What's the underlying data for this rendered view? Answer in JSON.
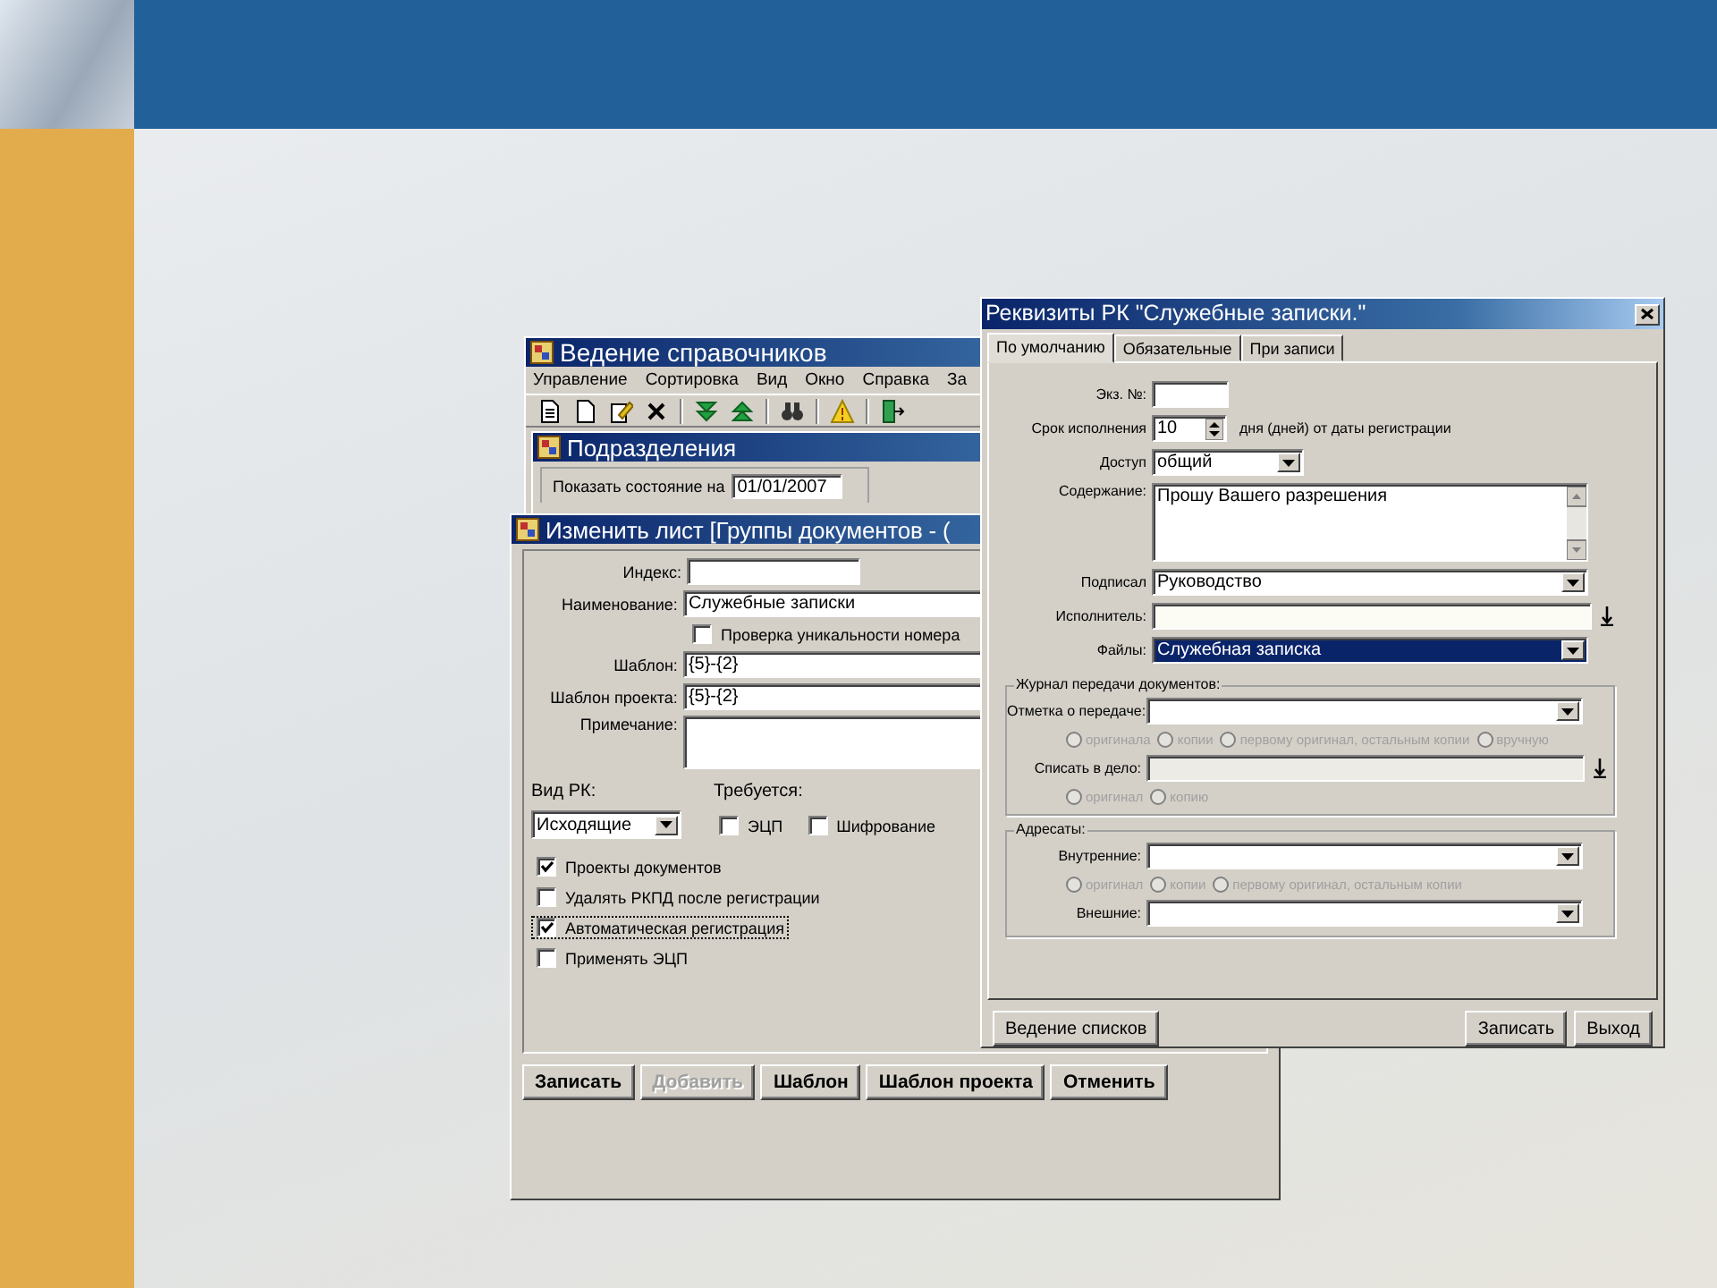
{
  "reference_window": {
    "title": "Ведение справочников",
    "menu": [
      "Управление",
      "Сортировка",
      "Вид",
      "Окно",
      "Справка",
      "За"
    ],
    "subwindow": {
      "title": "Подразделения",
      "date_label": "Показать состояние на",
      "date_value": "01/01/2007"
    }
  },
  "edit_window": {
    "title": "Изменить лист [Группы документов - (",
    "fields": [
      {
        "kind": "short",
        "label": "Индекс:"
      },
      {
        "kind": "wide",
        "label": "Наименование:",
        "value": "Служебные записки"
      },
      {
        "kind": "checkbox",
        "label": "Проверка уникальности номера",
        "checked": false
      },
      {
        "kind": "wide",
        "label": "Шаблон:",
        "value": "{5}-{2}"
      },
      {
        "kind": "wide",
        "label": "Шаблон проекта:",
        "value": "{5}-{2}"
      },
      {
        "kind": "memo",
        "label": "Примечание:"
      }
    ],
    "rk_type": {
      "label": "Вид РК:",
      "value": "Исходящие"
    },
    "required": {
      "label": "Требуется:",
      "options": [
        {
          "label": "ЭЦП",
          "checked": false
        },
        {
          "label": "Шифрование",
          "checked": false
        }
      ]
    },
    "options": [
      {
        "label": "Проекты документов",
        "checked": true,
        "focused": false
      },
      {
        "label": "Удалять РКПД после регистрации",
        "checked": false,
        "focused": false
      },
      {
        "label": "Автоматическая регистрация",
        "checked": true,
        "focused": true
      },
      {
        "label": "Применять ЭЦП",
        "checked": false,
        "focused": false
      }
    ],
    "buttons": [
      {
        "label": "Записать",
        "disabled": false
      },
      {
        "label": "Добавить",
        "disabled": true
      },
      {
        "label": "Шаблон",
        "disabled": false
      },
      {
        "label": "Шаблон проекта",
        "disabled": false
      },
      {
        "label": "Отменить",
        "disabled": false
      }
    ]
  },
  "dialog": {
    "title": "Реквизиты РК \"Служебные записки.\"",
    "tabs": [
      {
        "label": "По умолчанию",
        "selected": true
      },
      {
        "label": "Обязательные",
        "selected": false
      },
      {
        "label": "При записи",
        "selected": false
      }
    ],
    "rows": [
      {
        "kind": "short",
        "label": "Экз. №:"
      },
      {
        "kind": "spin",
        "label": "Срок исполнения",
        "value": "10",
        "suffix": "дня (дней) от даты регистрации"
      },
      {
        "kind": "combo_short",
        "label": "Доступ",
        "value": "общий"
      },
      {
        "kind": "memo",
        "label": "Содержание:",
        "value": "Прошу Вашего разрешения"
      },
      {
        "kind": "combo",
        "label": "Подписал",
        "value": "Руководство",
        "focused": false
      },
      {
        "kind": "lookup",
        "label": "Исполнитель:",
        "disabled": false
      },
      {
        "kind": "combo",
        "label": "Файлы:",
        "value": "Служебная записка",
        "focused": true
      }
    ],
    "groups": [
      {
        "title": "Журнал передачи документов:",
        "rows": [
          {
            "kind": "combo",
            "label": "Отметка о передаче:",
            "focused": false
          },
          {
            "kind": "radios",
            "options": [
              {
                "label": "оригинала",
                "selected": false,
                "disabled": true
              },
              {
                "label": "копии",
                "selected": false,
                "disabled": true
              },
              {
                "label": "первому оригинал, остальным копии",
                "selected": false,
                "disabled": true
              },
              {
                "label": "вручную",
                "selected": false,
                "disabled": true
              }
            ]
          },
          {
            "kind": "lookup",
            "label": "Списать в дело:",
            "disabled": true
          },
          {
            "kind": "radios",
            "options": [
              {
                "label": "оригинал",
                "selected": false,
                "disabled": true
              },
              {
                "label": "копию",
                "selected": false,
                "disabled": true
              }
            ]
          }
        ]
      },
      {
        "title": "Адресаты:",
        "rows": [
          {
            "kind": "combo",
            "label": "Внутренние:",
            "focused": false
          },
          {
            "kind": "radios",
            "options": [
              {
                "label": "оригинал",
                "selected": false,
                "disabled": true
              },
              {
                "label": "копии",
                "selected": false,
                "disabled": true
              },
              {
                "label": "первому оригинал, остальным копии",
                "selected": false,
                "disabled": true
              }
            ]
          },
          {
            "kind": "combo",
            "label": "Внешние:",
            "focused": false
          }
        ]
      }
    ],
    "buttons_left": [
      {
        "label": "Ведение списков"
      }
    ],
    "buttons_right": [
      {
        "label": "Записать"
      },
      {
        "label": "Выход"
      }
    ]
  }
}
